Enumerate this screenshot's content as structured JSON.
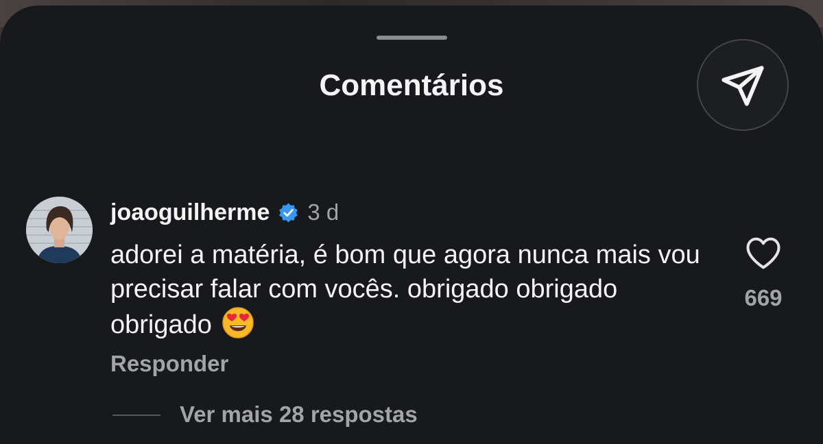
{
  "header": {
    "title": "Comentários",
    "share_icon": "paper-plane-icon"
  },
  "comment": {
    "username": "joaoguilherme",
    "verified": true,
    "time": "3 d",
    "text": "adorei a matéria, é bom que agora nunca mais vou precisar falar com vocês. obrigado obrigado obrigado",
    "emoji": "😍",
    "reply_label": "Responder",
    "like_icon": "heart-outline-icon",
    "likes": "669",
    "more_replies": "Ver mais 28 respostas"
  },
  "colors": {
    "sheet_bg": "#18191d",
    "text_primary": "#f4f4f5",
    "text_secondary": "#a3a4a8",
    "verified_blue": "#3897f0"
  }
}
